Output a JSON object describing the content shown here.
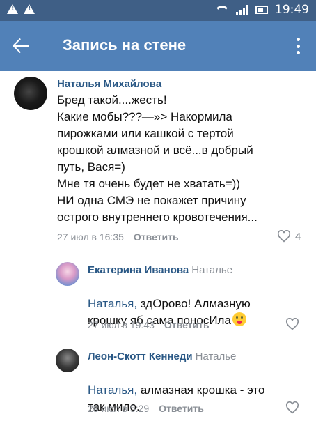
{
  "status_bar": {
    "time": "19:49"
  },
  "app_bar": {
    "title": "Запись на стене"
  },
  "comments": [
    {
      "author": "Наталья Михайловa",
      "text": "Бред такой....жесть!\nКакие мобы???—»> Накормила\nпирожками или кашкой с тертой\nкрошкой алмазной и всё...в добрый\nпуть, Вася=)\n Мне тя очень будет не хватать=))\nНИ одна СМЭ не покажет причину\nострого внутреннего кровотечения...",
      "date": "27 июл в 16:35",
      "reply_label": "Ответить",
      "likes": "4"
    },
    {
      "author": "Екатерина Иванова",
      "reply_to": "Наталье",
      "mention": "Наталья,",
      "text": " здОрово! Алмазную\nкрошку яб сама поносИла",
      "date": "27 июл в 19:43",
      "reply_label": "Ответить"
    },
    {
      "author": "Леон-Скотт Кеннеди",
      "reply_to": "Наталье",
      "mention": "Наталья,",
      "text": " алмазная крошка - это\nтак мило.",
      "date": "28 июл в 5:29",
      "reply_label": "Ответить"
    }
  ]
}
